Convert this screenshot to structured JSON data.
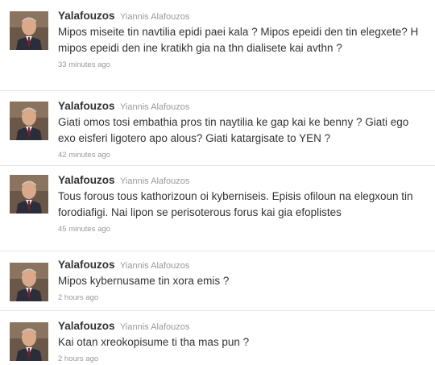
{
  "timeline": {
    "tweets": [
      {
        "screen_name": "Yalafouzos",
        "full_name": "Yiannis Alafouzos",
        "text": "Mipos miseite tin navtilia epidi paei kala ? Mipos epeidi den tin elegxete? H mipos epeidi den ine kratikh gia na thn dialisete kai avthn ?",
        "time": "33 minutes ago"
      },
      {
        "screen_name": "Yalafouzos",
        "full_name": "Yiannis Alafouzos",
        "text": "Giati omos tosi embathia pros tin naytilia ke gap kai ke benny ? Giati ego exo eisferi ligotero apo alous? Giati katargisate to YEN ?",
        "time": "42 minutes ago"
      },
      {
        "screen_name": "Yalafouzos",
        "full_name": "Yiannis Alafouzos",
        "text": "Tous forous tous kathorizoun oi kyberniseis. Episis ofiloun na elegxoun tin forodiafigi. Nai lipon se perisoterous forus kai gia efoplistes",
        "time": "45 minutes ago"
      },
      {
        "screen_name": "Yalafouzos",
        "full_name": "Yiannis Alafouzos",
        "text": "Mipos kybernusame tin xora emis ?",
        "time": "2 hours ago"
      },
      {
        "screen_name": "Yalafouzos",
        "full_name": "Yiannis Alafouzos",
        "text": "Kai otan xreokopisume ti tha mas pun ?",
        "time": "2 hours ago"
      }
    ]
  },
  "colors": {
    "screen_name": "#333333",
    "full_name": "#999999",
    "text": "#333333",
    "timestamp": "#999999",
    "divider": "#e5e5e5"
  }
}
